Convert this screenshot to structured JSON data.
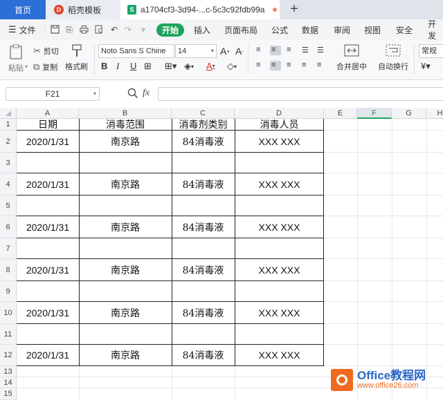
{
  "tabs": {
    "home": "首页",
    "template": "稻壳模板",
    "doc": "a1704cf3-3d94-...c-5c3c92fdb99a",
    "add_icon": "+"
  },
  "menu": {
    "file": "文件",
    "start": "开始",
    "items": [
      "插入",
      "页面布局",
      "公式",
      "数据",
      "审阅",
      "视图",
      "安全",
      "开发"
    ]
  },
  "ribbon": {
    "paste": "粘贴",
    "cut": "剪切",
    "copy": "复制",
    "format_painter": "格式刷",
    "font_name": "Noto Sans S Chine",
    "font_size": "14",
    "merge_center": "合并居中",
    "wrap_text": "自动换行",
    "number_format": "常规"
  },
  "formula_bar": {
    "cell_ref": "F21",
    "fx": "fx",
    "content": ""
  },
  "grid": {
    "columns": [
      "A",
      "B",
      "C",
      "D",
      "E",
      "F",
      "G",
      "H"
    ],
    "selected_column": "F",
    "rows": [
      "1",
      "2",
      "3",
      "4",
      "5",
      "6",
      "7",
      "8",
      "9",
      "10",
      "11",
      "12",
      "13",
      "14",
      "15"
    ],
    "table_header": [
      "日期",
      "消毒范围",
      "消毒剂类别",
      "消毒人员"
    ],
    "data_rows": {
      "r2": [
        "2020/1/31",
        "南京路",
        "84消毒液",
        "XXX XXX"
      ],
      "r4": [
        "2020/1/31",
        "南京路",
        "84消毒液",
        "XXX XXX"
      ],
      "r6": [
        "2020/1/31",
        "南京路",
        "84消毒液",
        "XXX XXX"
      ],
      "r8": [
        "2020/1/31",
        "南京路",
        "84消毒液",
        "XXX XXX"
      ],
      "r10": [
        "2020/1/31",
        "南京路",
        "84消毒液",
        "XXX XXX"
      ],
      "r12": [
        "2020/1/31",
        "南京路",
        "84消毒液",
        "XXX XXX"
      ]
    }
  },
  "watermark": {
    "title": "Office教程网",
    "url": "www.office26.com"
  },
  "colors": {
    "accent_green": "#1fa35b",
    "tab_blue": "#2c6fd6",
    "watermark_orange": "#ee6a20"
  }
}
